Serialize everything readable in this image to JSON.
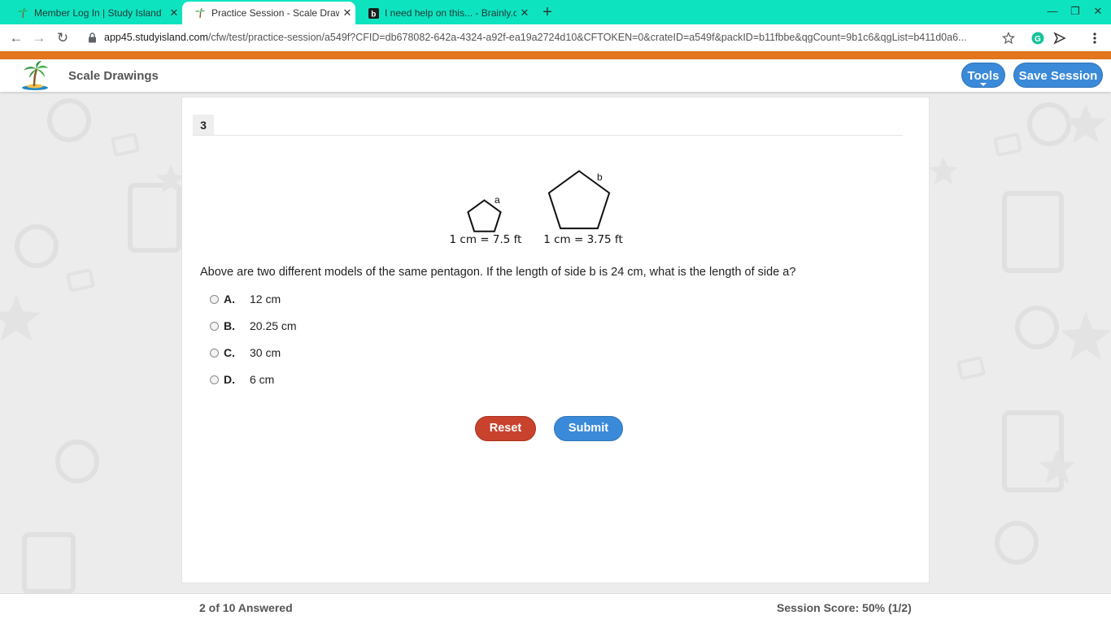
{
  "browser": {
    "tabs": [
      {
        "title": "Member Log In | Study Island",
        "icon": "palm-tree-icon",
        "active": false
      },
      {
        "title": "Practice Session - Scale Drawings",
        "icon": "palm-tree-icon",
        "active": true
      },
      {
        "title": "I need help on this... - Brainly.com",
        "icon": "brainly-icon",
        "active": false
      }
    ],
    "url_host": "app45.studyisland.com",
    "url_path": "/cfw/test/practice-session/a549f?CFID=db678082-642a-4324-a92f-ea19a2724d10&CFTOKEN=0&crateID=a549f&packID=b11fbbe&qgCount=9b1c6&qgList=b411d0a6..."
  },
  "header": {
    "title": "Scale Drawings",
    "tools_label": "Tools",
    "save_label": "Save Session"
  },
  "question": {
    "number": "3",
    "figure": {
      "label_a": "a",
      "label_b": "b",
      "scale_a": "1 cm = 7.5 ft",
      "scale_b": "1 cm = 3.75 ft"
    },
    "text": "Above are two different models of the same pentagon. If the length of side b is 24 cm, what is the length of side a?",
    "choices": [
      {
        "letter": "A.",
        "text": "12 cm"
      },
      {
        "letter": "B.",
        "text": "20.25 cm"
      },
      {
        "letter": "C.",
        "text": "30 cm"
      },
      {
        "letter": "D.",
        "text": "6 cm"
      }
    ],
    "reset_label": "Reset",
    "submit_label": "Submit"
  },
  "footer": {
    "answered": "2 of 10 Answered",
    "score": "Session Score: 50% (1/2)"
  },
  "colors": {
    "tabbar": "#0ee3c0",
    "accent_orange": "#e3751c",
    "button_blue": "#3a8ad9",
    "button_red": "#c8422e"
  }
}
